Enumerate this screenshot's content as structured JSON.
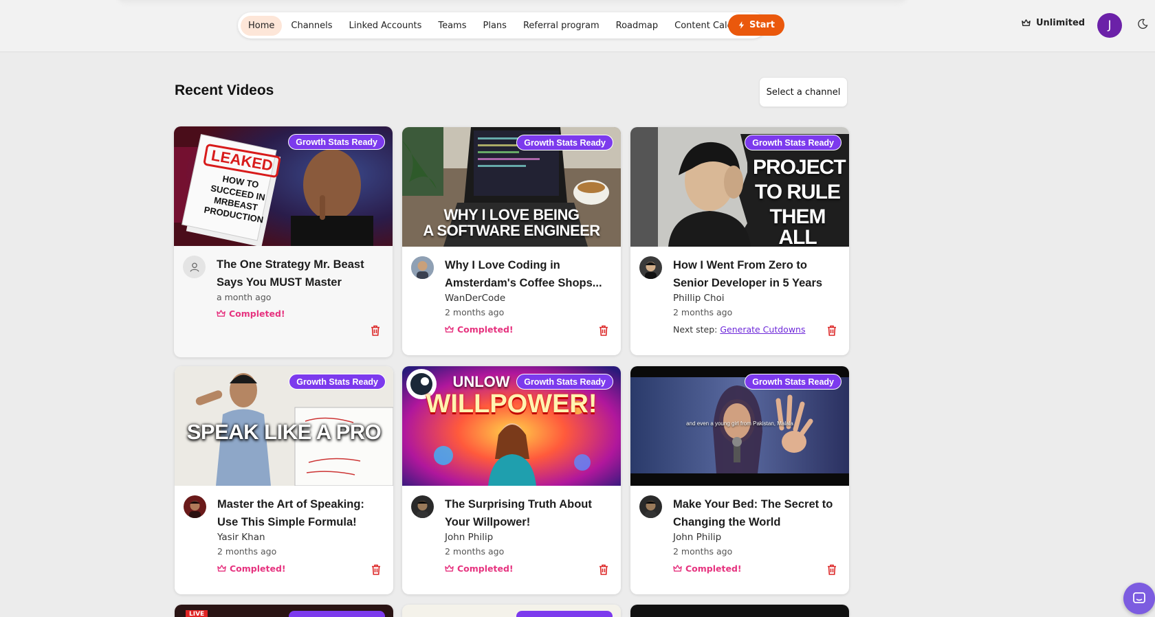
{
  "nav": {
    "items": [
      {
        "label": "Home",
        "active": true
      },
      {
        "label": "Channels"
      },
      {
        "label": "Linked Accounts"
      },
      {
        "label": "Teams"
      },
      {
        "label": "Plans"
      },
      {
        "label": "Referral program"
      },
      {
        "label": "Roadmap"
      },
      {
        "label": "Content Calendar"
      }
    ],
    "start_label": "Start",
    "plan_label": "Unlimited",
    "avatar_initial": "J"
  },
  "page": {
    "title": "Recent Videos",
    "select_channel_label": "Select a channel"
  },
  "colors": {
    "accent_orange": "#ea580c",
    "badge_purple": "#7c3aed",
    "status_pink": "#e6337f",
    "trash_red": "#dc2626",
    "avatar_purple": "#6b21a8"
  },
  "badge_label": "Growth Stats Ready",
  "videos": [
    {
      "title": "The One Strategy Mr. Beast\nSays You MUST Master",
      "channel": "",
      "date": "a month ago",
      "status": "Completed!",
      "thumb_text": [
        "LEAKED",
        "HOW TO",
        "SUCCEED IN",
        "MRBEAST",
        "PRODUCTION"
      ],
      "avatar_icon": "user-icon"
    },
    {
      "title": "Why I Love Coding in\nAmsterdam's Coffee Shops...",
      "channel": "WanDerCode",
      "date": "2 months ago",
      "status": "Completed!",
      "thumb_text": [
        "WHY I LOVE BEING",
        "A SOFTWARE ENGINEER"
      ]
    },
    {
      "title": "How I Went From Zero to\nSenior Developer in 5 Years",
      "channel": "Phillip Choi",
      "date": "2 months ago",
      "next_step_label": "Next step:",
      "next_step_link": "Generate Cutdowns",
      "thumb_text": [
        "PROJECT",
        "TO RULE",
        "THEM ALL"
      ]
    },
    {
      "title": "Master the Art of Speaking:\nUse This Simple Formula!",
      "channel": "Yasir Khan",
      "date": "2 months ago",
      "status": "Completed!",
      "thumb_text": [
        "SPEAK LIKE A PRO"
      ]
    },
    {
      "title": "The Surprising Truth About\nYour Willpower!",
      "channel": "John Philip",
      "date": "2 months ago",
      "status": "Completed!",
      "thumb_text": [
        "UNLOW",
        "WILLPOWER!"
      ]
    },
    {
      "title": "Make Your Bed: The Secret to\nChanging the World",
      "channel": "John Philip",
      "date": "2 months ago",
      "status": "Completed!",
      "thumb_text": [
        "and even a young girl from Pakistan, Malala"
      ]
    }
  ],
  "partial_row": {
    "live_label": "LIVE"
  }
}
